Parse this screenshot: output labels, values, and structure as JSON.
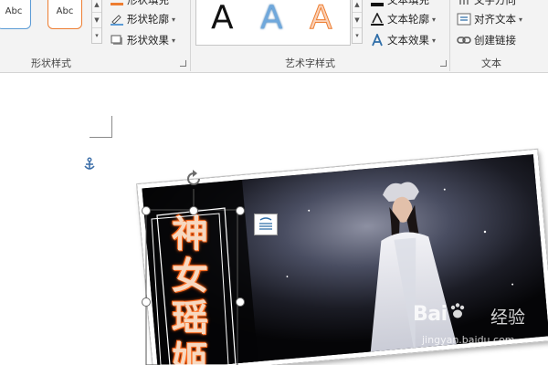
{
  "ribbon": {
    "shape_styles": {
      "label": "形状样式",
      "swatches": [
        "Abc",
        "Abc"
      ],
      "commands": {
        "fill": "形状填充",
        "outline": "形状轮廓",
        "effects": "形状效果"
      }
    },
    "wordart_styles": {
      "label": "艺术字样式",
      "gallery": [
        "A",
        "A",
        "A"
      ],
      "commands": {
        "fill": "文本填充",
        "outline": "文本轮廓",
        "effects": "文本效果"
      }
    },
    "text": {
      "label": "文本",
      "commands": {
        "direction": "文字方向",
        "align": "对齐文本",
        "link": "创建链接"
      }
    }
  },
  "document": {
    "wordart_text": "神女瑶姬"
  },
  "watermark": {
    "brand_left": "Bai",
    "brand_right": "经验",
    "url": "jingyan.baidu.com"
  },
  "colors": {
    "ribbon_bg": "#f3f3f3",
    "accent_blue": "#5b9bd5",
    "accent_orange": "#ed7d31",
    "wordart_glow": "#ff6a20"
  }
}
